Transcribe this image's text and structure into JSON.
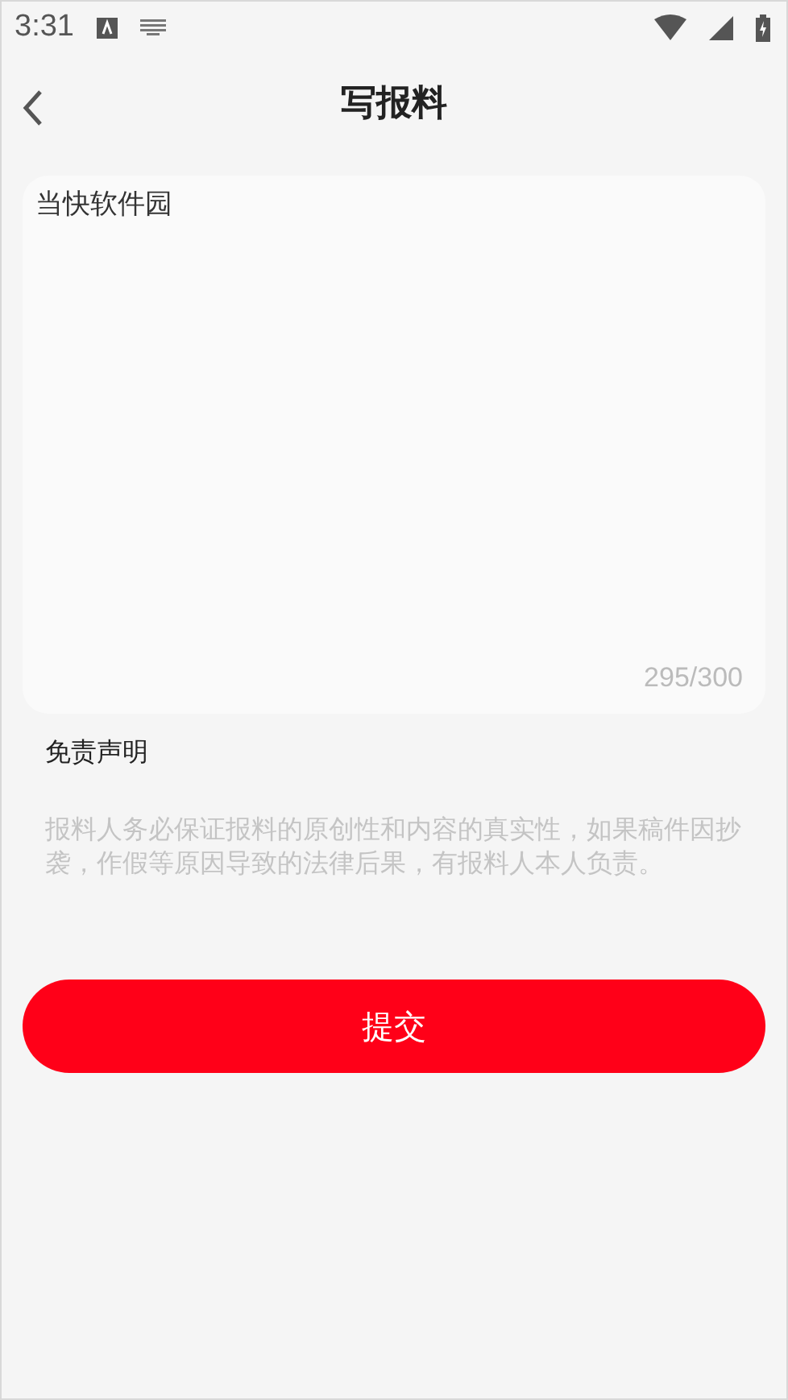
{
  "status_bar": {
    "time": "3:31"
  },
  "header": {
    "title": "写报料"
  },
  "editor": {
    "value": "当快软件园",
    "counter": "295/300"
  },
  "disclaimer": {
    "title": "免责声明",
    "text": "报料人务必保证报料的原创性和内容的真实性，如果稿件因抄袭，作假等原因导致的法律后果，有报料人本人负责。"
  },
  "submit_button": {
    "label": "提交"
  }
}
